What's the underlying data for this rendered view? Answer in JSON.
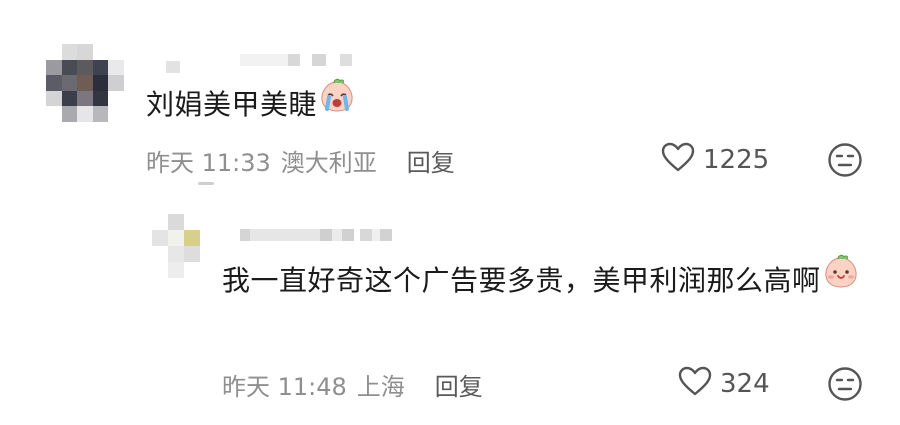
{
  "comments": [
    {
      "text": "刘娟美甲美睫",
      "emoji": "crying-face-emoji",
      "time": "昨天 11:33",
      "location": "澳大利亚",
      "reply_label": "回复",
      "likes": "1225"
    }
  ],
  "replies": [
    {
      "text": "我一直好奇这个广告要多贵，美甲利润那么高啊",
      "emoji": "smiling-face-emoji",
      "time": "昨天 11:48",
      "location": "上海",
      "reply_label": "回复",
      "likes": "324"
    }
  ],
  "icons": {
    "like": "heart-outline-icon",
    "dislike": "unhappy-face-icon"
  },
  "colors": {
    "text": "#1b1b1b",
    "meta": "#8f8f8f",
    "icon": "#555555"
  }
}
